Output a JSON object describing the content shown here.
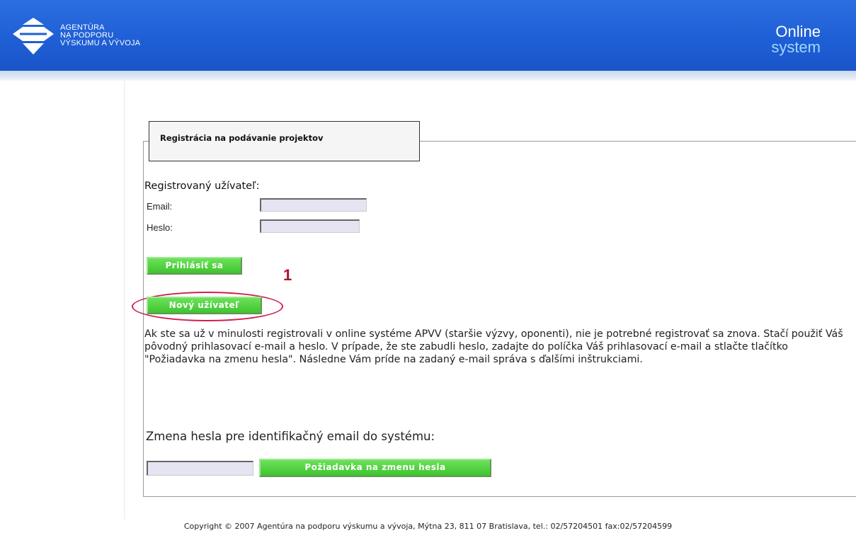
{
  "header": {
    "logo_lines": [
      "AGENTÚRA",
      "NA PODPORU",
      "VÝSKUMU A VÝVOJA"
    ],
    "brand_line1": "Online",
    "brand_line2": "system",
    "bg_color": "#1f5fd6"
  },
  "tab": {
    "label": "Registrácia na podávanie projektov"
  },
  "login": {
    "title": "Registrovaný užívateľ:",
    "email_label": "Email:",
    "email_value": "",
    "password_label": "Heslo:",
    "password_value": "",
    "login_button": "Prihlásiť sa",
    "new_user_button": "Nový užívateľ",
    "annotation_marker": "1"
  },
  "info_text": "Ak ste sa už v minulosti registrovali v online systéme APVV (staršie výzvy, oponenti), nie je potrebné registrovať sa znova. Stačí použiť Váš pôvodný prihlasovací e-mail a heslo. V prípade, že ste zabudli heslo, zadajte do políčka Váš prihlasovací e-mail a stlačte tlačítko \"Požiadavka na zmenu hesla\". Následne Vám príde na zadaný e-mail správa s ďalšími inštrukciami.",
  "password_change": {
    "title": "Zmena hesla pre identifikačný email do systému:",
    "email_value": "",
    "button": "Požiadavka na zmenu hesla"
  },
  "colors": {
    "button_green": "#3fc42f",
    "annotation_red": "#b0102e"
  },
  "footer": "Copyright © 2007 Agentúra na podporu výskumu a vývoja, Mýtna 23, 811 07 Bratislava, tel.: 02/57204501 fax:02/57204599"
}
